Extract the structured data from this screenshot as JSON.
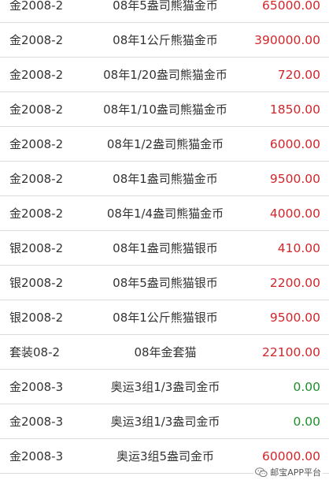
{
  "rows": [
    {
      "code": "金2008-2",
      "name": "08年5盎司熊猫金币",
      "price": "65000.00",
      "price_color": "red"
    },
    {
      "code": "金2008-2",
      "name": "08年1公斤熊猫金币",
      "price": "390000.00",
      "price_color": "red"
    },
    {
      "code": "金2008-2",
      "name": "08年1/20盎司熊猫金币",
      "price": "720.00",
      "price_color": "red"
    },
    {
      "code": "金2008-2",
      "name": "08年1/10盎司熊猫金币",
      "price": "1850.00",
      "price_color": "red"
    },
    {
      "code": "金2008-2",
      "name": "08年1/2盎司熊猫金币",
      "price": "6000.00",
      "price_color": "red"
    },
    {
      "code": "金2008-2",
      "name": "08年1盎司熊猫金币",
      "price": "9500.00",
      "price_color": "red"
    },
    {
      "code": "金2008-2",
      "name": "08年1/4盎司熊猫金币",
      "price": "4000.00",
      "price_color": "red"
    },
    {
      "code": "银2008-2",
      "name": "08年1盎司熊猫银币",
      "price": "410.00",
      "price_color": "red"
    },
    {
      "code": "银2008-2",
      "name": "08年5盎司熊猫银币",
      "price": "2200.00",
      "price_color": "red"
    },
    {
      "code": "银2008-2",
      "name": "08年1公斤熊猫银币",
      "price": "9500.00",
      "price_color": "red"
    },
    {
      "code": "套装08-2",
      "name": "08年金套猫",
      "price": "22100.00",
      "price_color": "red"
    },
    {
      "code": "金2008-3",
      "name": "奥运3组1/3盎司金币",
      "price": "0.00",
      "price_color": "green"
    },
    {
      "code": "金2008-3",
      "name": "奥运3组1/3盎司金币",
      "price": "0.00",
      "price_color": "green"
    },
    {
      "code": "金2008-3",
      "name": "奥运3组5盎司金币",
      "price": "60000.00",
      "price_color": "red"
    }
  ],
  "watermark": {
    "text": "邮宝APP平台",
    "icon": "wechat-icon"
  },
  "colors": {
    "price_up": "#d0262b",
    "price_zero": "#1e8f2a",
    "divider": "#dcdcdc",
    "text": "#333333"
  }
}
